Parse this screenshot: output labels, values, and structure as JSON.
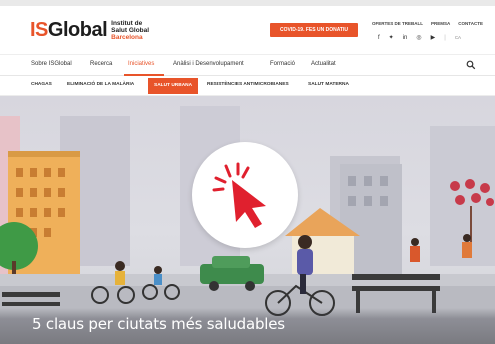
{
  "header": {
    "logo": {
      "is": "IS",
      "global": "Global",
      "line1": "Institut de",
      "line2": "Salut Global",
      "city": "Barcelona"
    },
    "donate_label": "COVID-19. FES UN DONATIU",
    "top_links": [
      "OFERTES DE TREBALL",
      "PREMSA",
      "CONTACTE"
    ],
    "social_icons": [
      "facebook-icon",
      "twitter-icon",
      "linkedin-icon",
      "instagram-icon",
      "youtube-icon"
    ],
    "social_glyphs": [
      "f",
      "✦",
      "in",
      "◎",
      "▶"
    ],
    "language": "CA"
  },
  "mainnav": {
    "items": [
      "Sobre ISGlobal",
      "Recerca",
      "Iniciatives",
      "Anàlisi i Desenvolupament",
      "Formació",
      "Actualitat"
    ],
    "active_index": 2
  },
  "subnav": {
    "items": [
      "CHAGAS",
      "ELIMINACIÓ DE LA MALÀRIA",
      "SALUT URBANA",
      "RESISTÈNCIES ANTIMICROBIANES",
      "SALUT MATERNA"
    ],
    "active_index": 2
  },
  "hero": {
    "caption": "5 claus per ciutats més saludables"
  },
  "colors": {
    "accent": "#e8542a",
    "badge_arrow": "#e0202e",
    "text_dark": "#1d1d1d"
  }
}
